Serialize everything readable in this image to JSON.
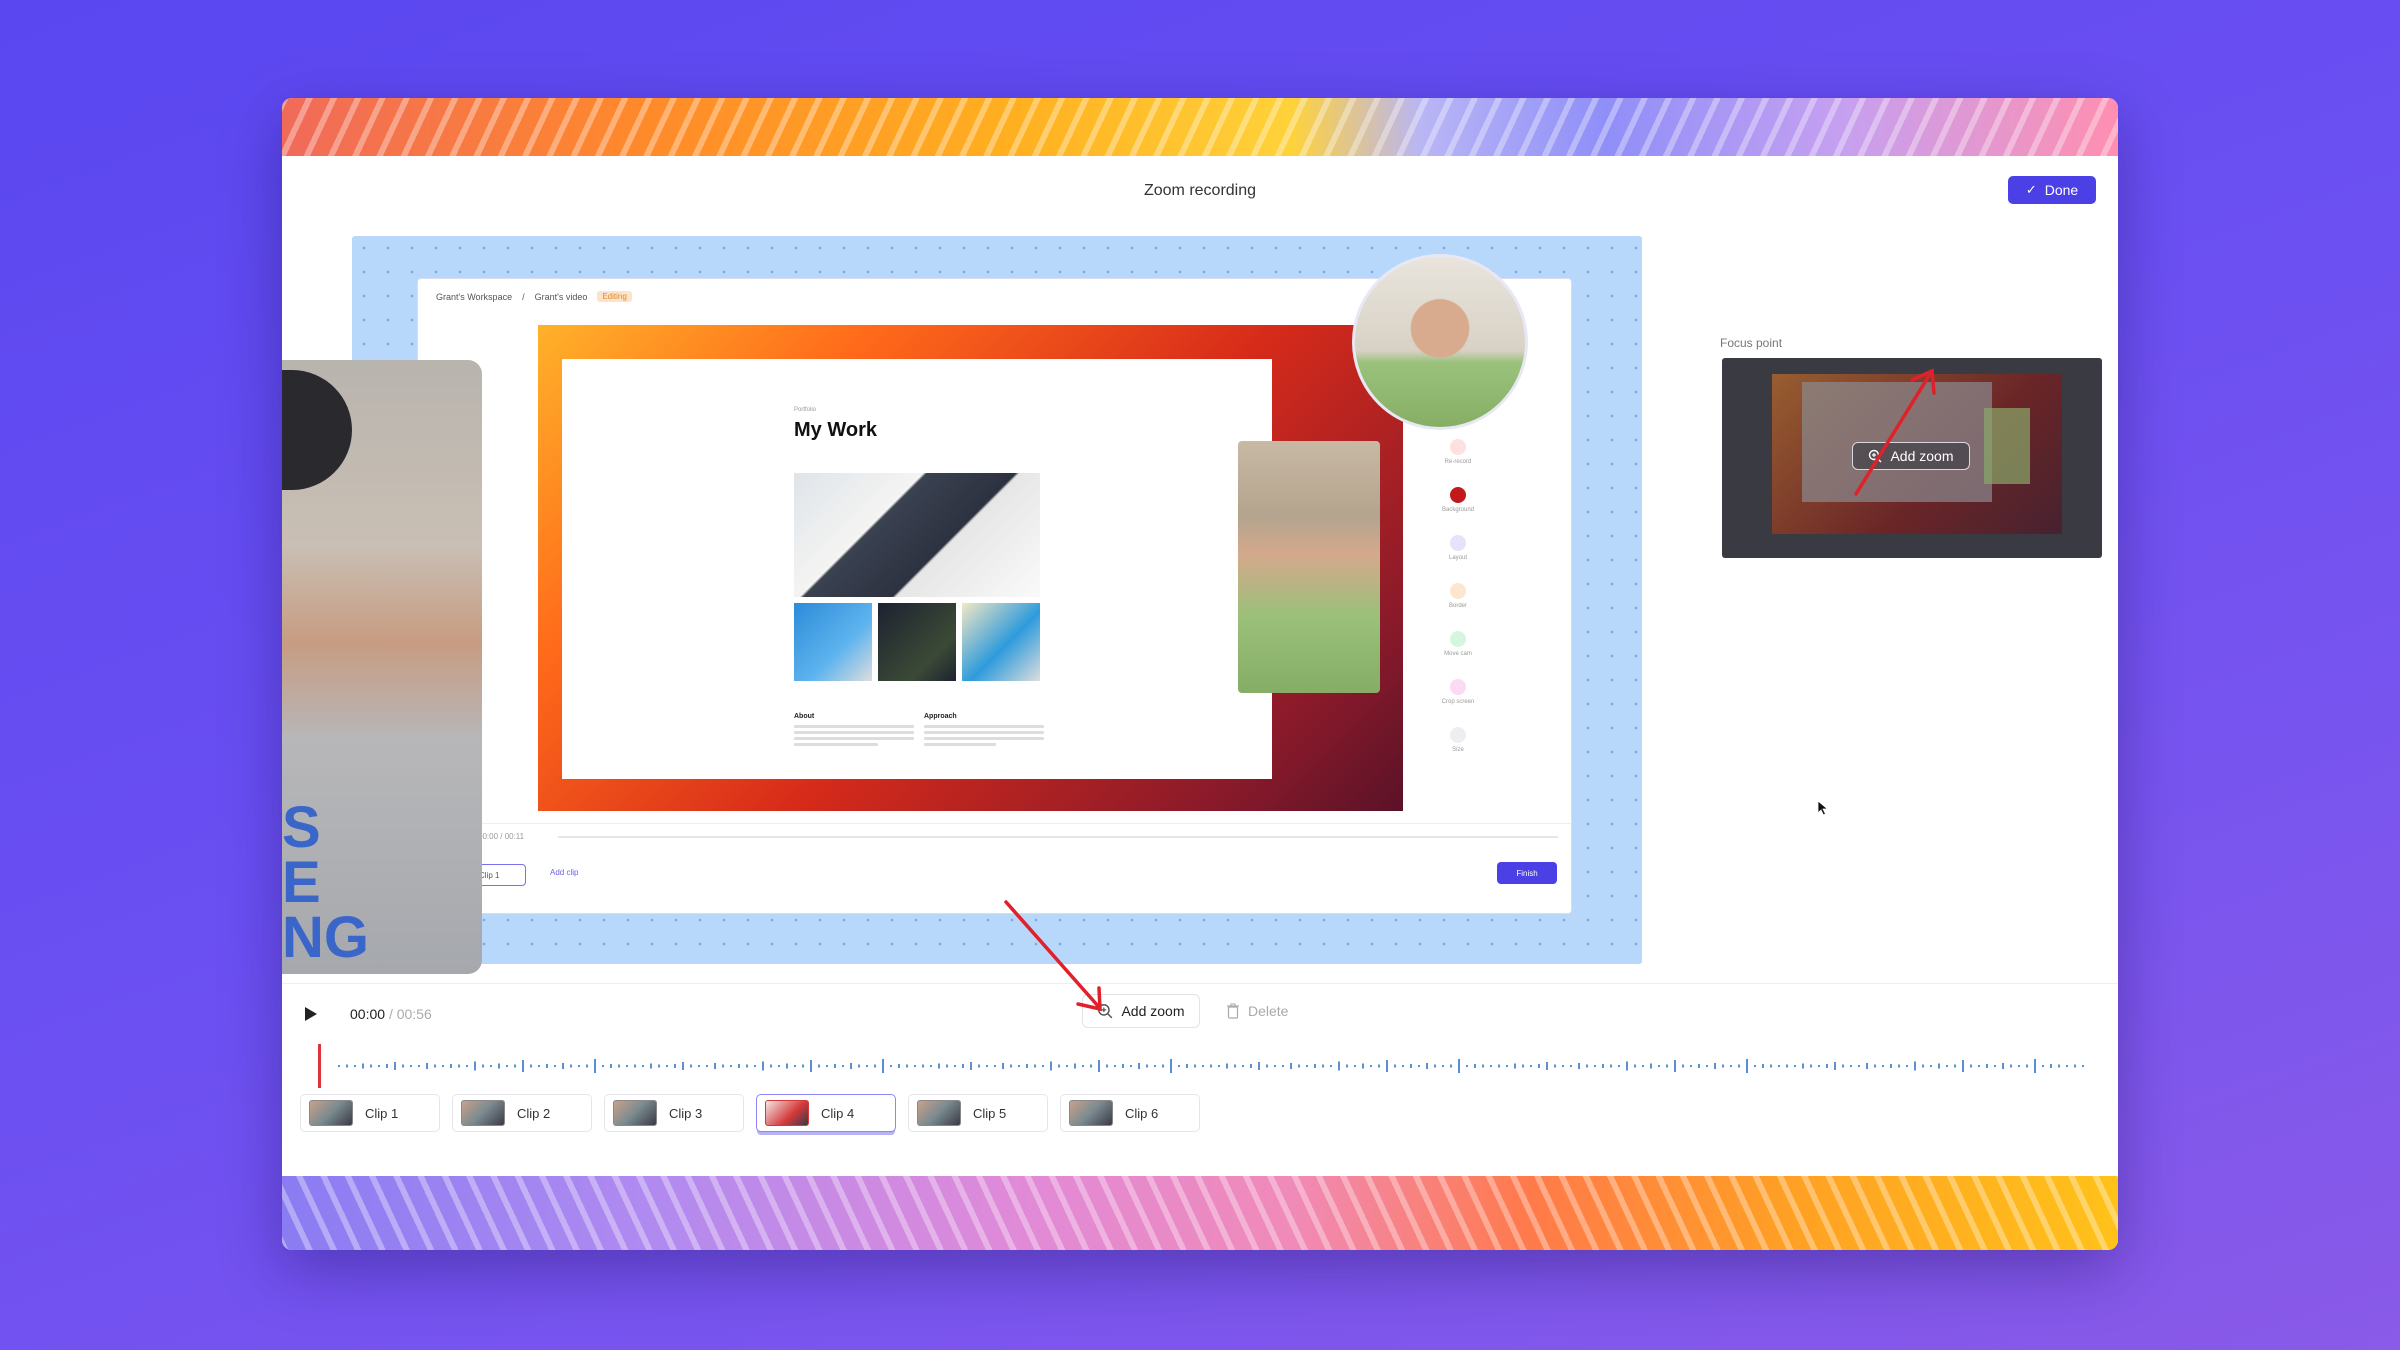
{
  "window": {
    "title": "Zoom recording",
    "done_label": "Done"
  },
  "recording": {
    "breadcrumb": {
      "workspace": "Grant's Workspace",
      "separator": "/",
      "video": "Grant's video",
      "tag": "Editing"
    },
    "document": {
      "eyebrow": "Portfolio",
      "title": "My Work",
      "col_left": "About",
      "col_right": "Approach"
    },
    "side_tools": [
      "Re-record",
      "Background",
      "Layout",
      "Border",
      "Move cam",
      "Crop screen",
      "Size"
    ],
    "timeline": {
      "time": "00:00 / 00:11",
      "clip": "Clip 1",
      "add_clip": "Add clip",
      "finish": "Finish"
    },
    "shirt_text": "S\nE\nNG"
  },
  "focus": {
    "label": "Focus point",
    "button_label": "Add zoom"
  },
  "controls": {
    "time_current": "00:00",
    "time_total": "/ 00:56",
    "add_zoom_label": "Add zoom",
    "delete_label": "Delete",
    "progress": 0
  },
  "clips": [
    {
      "label": "Clip 1",
      "active": false
    },
    {
      "label": "Clip 2",
      "active": false
    },
    {
      "label": "Clip 3",
      "active": false
    },
    {
      "label": "Clip 4",
      "active": true
    },
    {
      "label": "Clip 5",
      "active": false
    },
    {
      "label": "Clip 6",
      "active": false
    }
  ],
  "colors": {
    "accent": "#4b3fe6",
    "annotation_arrow": "#e0202a",
    "playhead": "#e0323a",
    "waveform": "#5a8fd8"
  },
  "icons": {
    "play": "play-icon",
    "zoom": "zoom-in-icon",
    "delete": "trash-icon",
    "done": "check-icon"
  }
}
